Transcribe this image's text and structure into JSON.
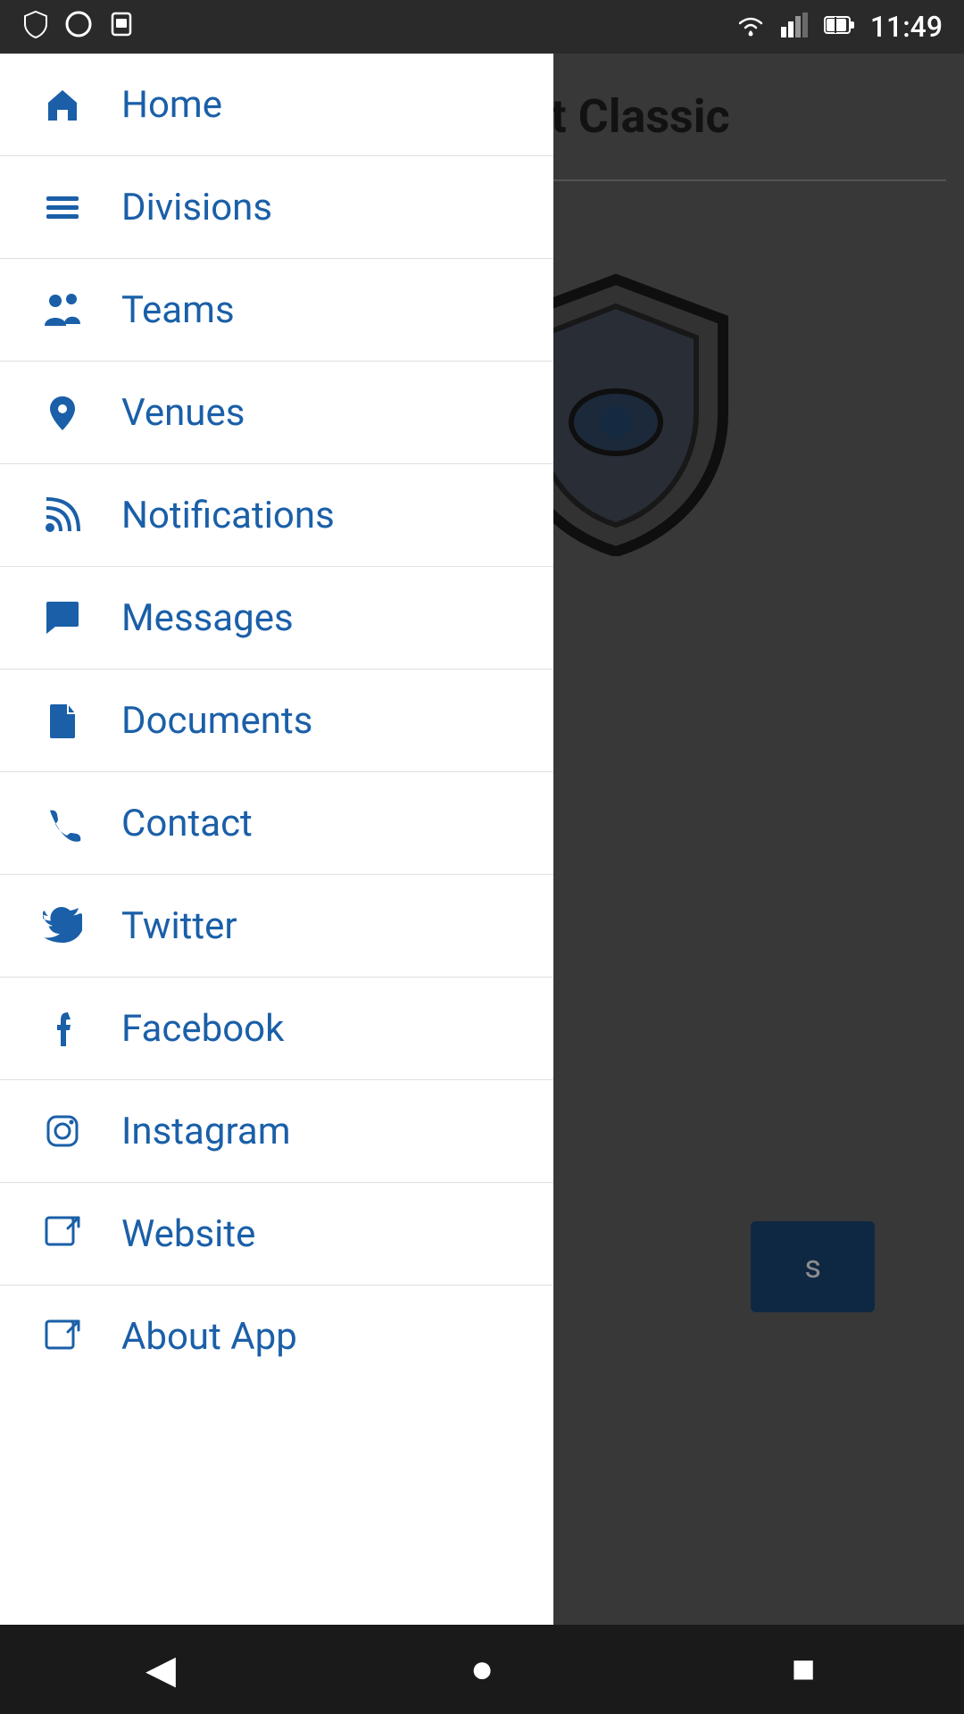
{
  "statusBar": {
    "time": "11:49",
    "icons": {
      "shield": "🛡",
      "circle": "⬤",
      "card": "▬",
      "wifi": "▲",
      "signal": "▲",
      "battery": "🔋"
    }
  },
  "header": {
    "title": "oat Classic"
  },
  "nav": {
    "items": [
      {
        "id": "home",
        "label": "Home",
        "icon": "⌂",
        "iconName": "home-icon"
      },
      {
        "id": "divisions",
        "label": "Divisions",
        "icon": "≡",
        "iconName": "divisions-icon"
      },
      {
        "id": "teams",
        "label": "Teams",
        "icon": "👥",
        "iconName": "teams-icon"
      },
      {
        "id": "venues",
        "label": "Venues",
        "icon": "📍",
        "iconName": "venues-icon"
      },
      {
        "id": "notifications",
        "label": "Notifications",
        "icon": "📡",
        "iconName": "notifications-icon"
      },
      {
        "id": "messages",
        "label": "Messages",
        "icon": "💬",
        "iconName": "messages-icon"
      },
      {
        "id": "documents",
        "label": "Documents",
        "icon": "📄",
        "iconName": "documents-icon"
      },
      {
        "id": "contact",
        "label": "Contact",
        "icon": "📞",
        "iconName": "contact-icon"
      },
      {
        "id": "twitter",
        "label": "Twitter",
        "icon": "🐦",
        "iconName": "twitter-icon"
      },
      {
        "id": "facebook",
        "label": "Facebook",
        "icon": "f",
        "iconName": "facebook-icon"
      },
      {
        "id": "instagram",
        "label": "Instagram",
        "icon": "📷",
        "iconName": "instagram-icon"
      },
      {
        "id": "website",
        "label": "Website",
        "icon": "↗",
        "iconName": "website-icon"
      },
      {
        "id": "about",
        "label": "About App",
        "icon": "↗",
        "iconName": "about-icon"
      }
    ]
  },
  "bottomNav": {
    "back": "◀",
    "home": "●",
    "recent": "■"
  },
  "colors": {
    "accent": "#1a5fa8",
    "drawerBg": "#ffffff",
    "statusBar": "#2a2a2a",
    "bottomNav": "#1a1a1a",
    "bgOverlay": "rgba(0,0,0,0.45)",
    "headerBg": "#1a4a7a"
  }
}
